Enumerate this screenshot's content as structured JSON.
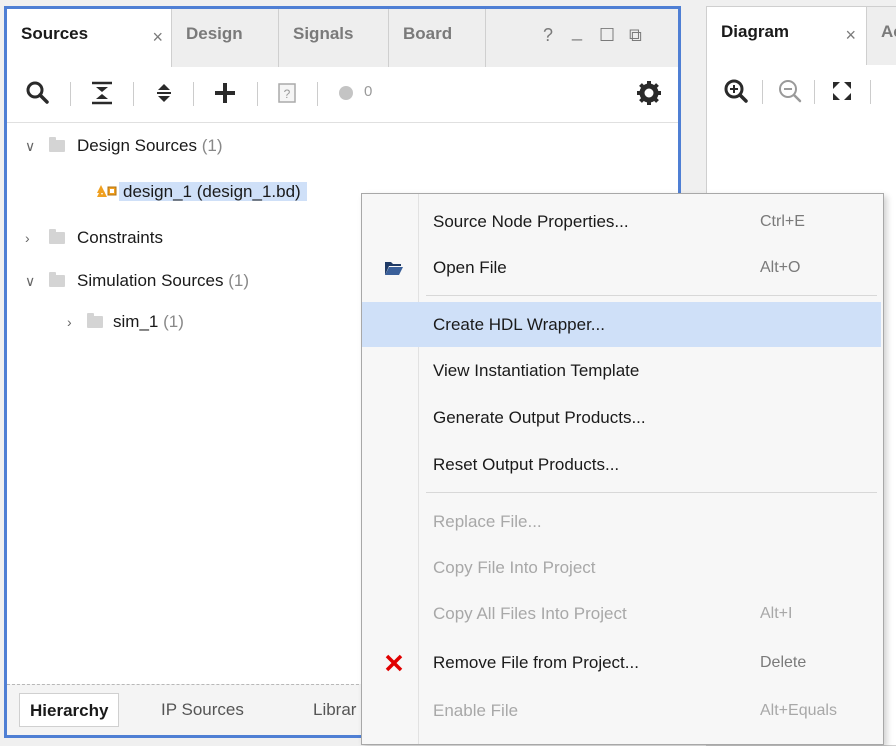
{
  "sources_panel": {
    "tabs": [
      {
        "label": "Sources",
        "active": true
      },
      {
        "label": "Design",
        "active": false
      },
      {
        "label": "Signals",
        "active": false
      },
      {
        "label": "Board",
        "active": false
      }
    ],
    "window_controls": {
      "help": "?",
      "minimize": "_",
      "maximize": "☐",
      "float": "⧉"
    },
    "toolbar": {
      "warning_count": "0"
    },
    "tree": {
      "design_sources": {
        "label": "Design Sources",
        "count": "(1)"
      },
      "design_file": {
        "label": "design_1 (design_1.bd)"
      },
      "constraints": {
        "label": "Constraints"
      },
      "simulation_sources": {
        "label": "Simulation Sources",
        "count": "(1)"
      },
      "sim_1": {
        "label": "sim_1",
        "count": "(1)"
      }
    },
    "bottom_tabs": [
      {
        "label": "Hierarchy",
        "active": true
      },
      {
        "label": "IP Sources",
        "active": false
      },
      {
        "label": "Librar",
        "active": false
      }
    ]
  },
  "diagram_panel": {
    "tabs": [
      {
        "label": "Diagram",
        "active": true
      },
      {
        "label": "Ac",
        "active": false
      }
    ]
  },
  "context_menu": {
    "items": [
      {
        "label": "Source Node Properties...",
        "shortcut": "Ctrl+E",
        "enabled": true
      },
      {
        "label": "Open File",
        "shortcut": "Alt+O",
        "enabled": true,
        "icon": "folder-open-icon"
      },
      {
        "label": "Create HDL Wrapper...",
        "shortcut": "",
        "enabled": true,
        "highlighted": true
      },
      {
        "label": "View Instantiation Template",
        "shortcut": "",
        "enabled": true
      },
      {
        "label": "Generate Output Products...",
        "shortcut": "",
        "enabled": true
      },
      {
        "label": "Reset Output Products...",
        "shortcut": "",
        "enabled": true
      },
      {
        "label": "Replace File...",
        "shortcut": "",
        "enabled": false
      },
      {
        "label": "Copy File Into Project",
        "shortcut": "",
        "enabled": false
      },
      {
        "label": "Copy All Files Into Project",
        "shortcut": "Alt+I",
        "enabled": false
      },
      {
        "label": "Remove File from Project...",
        "shortcut": "Delete",
        "enabled": true,
        "icon": "red-x-icon"
      },
      {
        "label": "Enable File",
        "shortcut": "Alt+Equals",
        "enabled": false
      }
    ]
  },
  "colors": {
    "panel_border_focus": "#4f7fd4",
    "selection": "#cfe0f8",
    "remove_icon": "#e00000"
  }
}
